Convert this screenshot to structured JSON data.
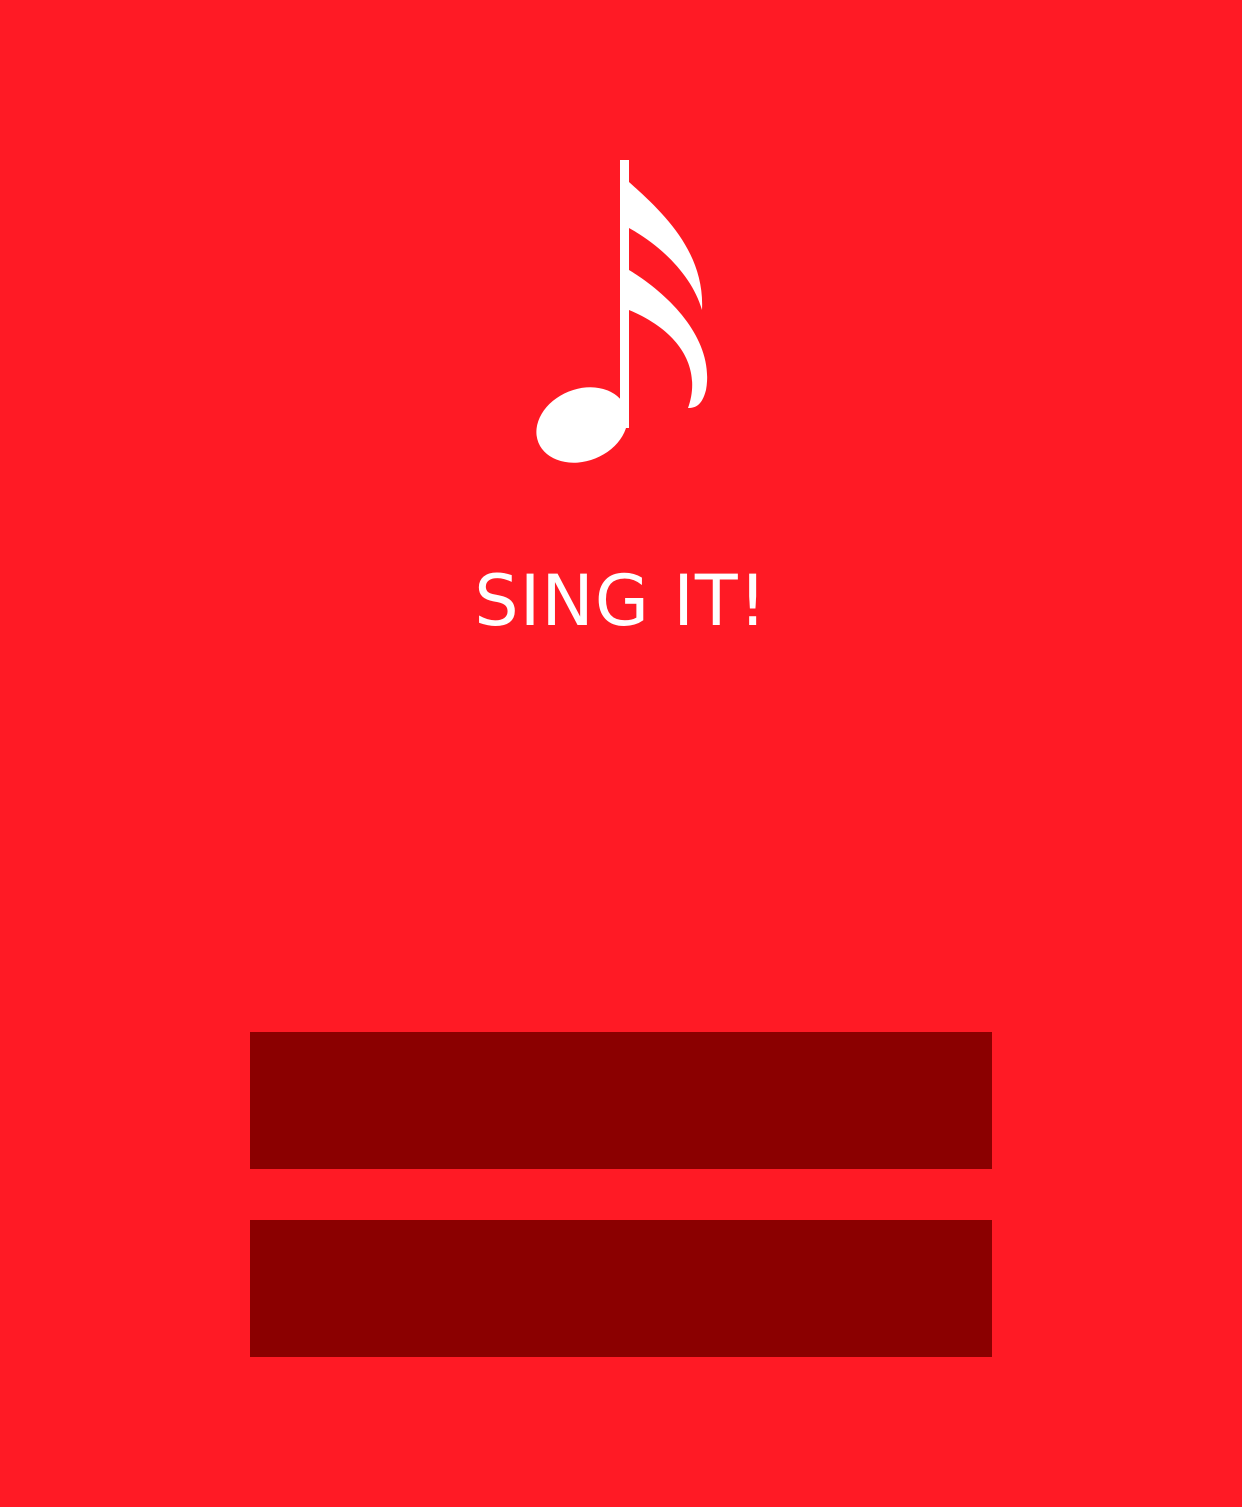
{
  "app": {
    "title": "SING IT!",
    "logo_icon": "sixteenth-note-icon"
  },
  "buttons": [
    {
      "label": ""
    },
    {
      "label": ""
    }
  ],
  "colors": {
    "background": "#ff1a25",
    "button": "#8b0000",
    "foreground": "#ffffff"
  }
}
